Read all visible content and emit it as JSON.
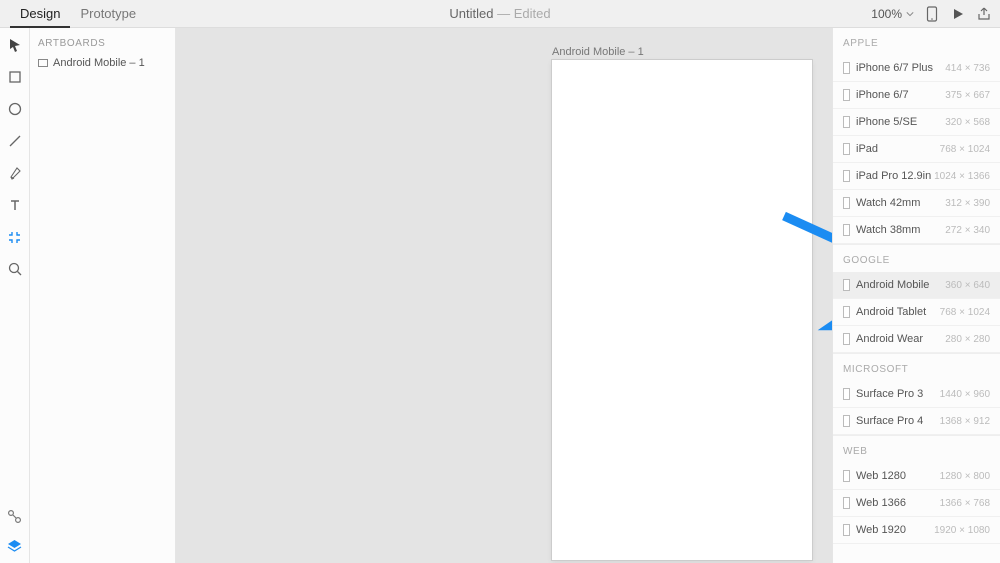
{
  "topbar": {
    "tabs": {
      "design": "Design",
      "prototype": "Prototype"
    },
    "title_main": "Untitled",
    "title_suffix": " — Edited",
    "zoom": "100%"
  },
  "left": {
    "section": "ARTBOARDS",
    "items": [
      {
        "label": "Android Mobile – 1"
      }
    ]
  },
  "canvas": {
    "artboard_label": "Android Mobile – 1"
  },
  "right": {
    "groups": [
      {
        "title": "APPLE",
        "presets": [
          {
            "name": "iPhone 6/7 Plus",
            "dims": "414 × 736"
          },
          {
            "name": "iPhone 6/7",
            "dims": "375 × 667"
          },
          {
            "name": "iPhone 5/SE",
            "dims": "320 × 568"
          },
          {
            "name": "iPad",
            "dims": "768 × 1024"
          },
          {
            "name": "iPad Pro 12.9in",
            "dims": "1024 × 1366"
          },
          {
            "name": "Watch 42mm",
            "dims": "312 × 390"
          },
          {
            "name": "Watch 38mm",
            "dims": "272 × 340"
          }
        ]
      },
      {
        "title": "GOOGLE",
        "presets": [
          {
            "name": "Android Mobile",
            "dims": "360 × 640",
            "selected": true
          },
          {
            "name": "Android Tablet",
            "dims": "768 × 1024"
          },
          {
            "name": "Android Wear",
            "dims": "280 × 280"
          }
        ]
      },
      {
        "title": "MICROSOFT",
        "presets": [
          {
            "name": "Surface Pro 3",
            "dims": "1440 × 960"
          },
          {
            "name": "Surface Pro 4",
            "dims": "1368 × 912"
          }
        ]
      },
      {
        "title": "WEB",
        "presets": [
          {
            "name": "Web 1280",
            "dims": "1280 × 800"
          },
          {
            "name": "Web 1366",
            "dims": "1366 × 768"
          },
          {
            "name": "Web 1920",
            "dims": "1920 × 1080"
          }
        ]
      }
    ]
  }
}
